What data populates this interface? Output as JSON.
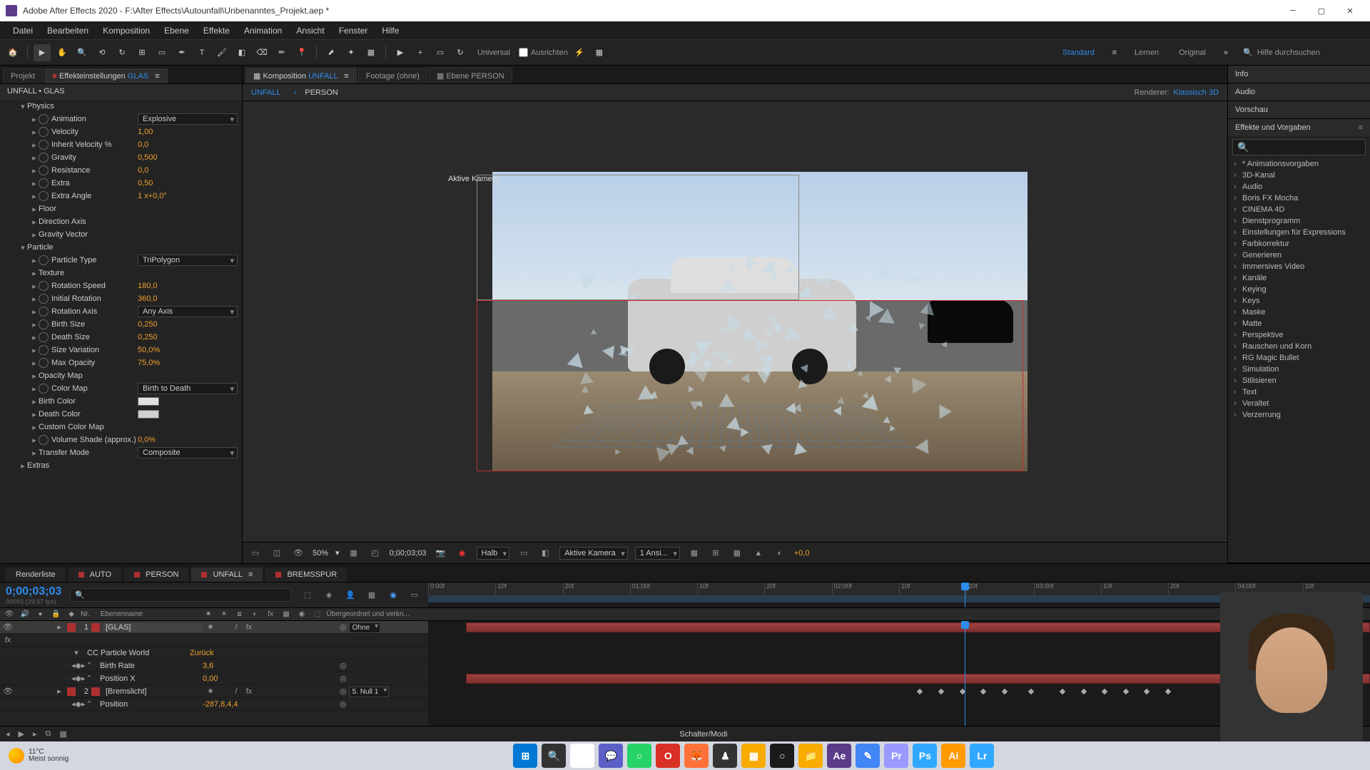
{
  "titlebar": {
    "title": "Adobe After Effects 2020 - F:\\After Effects\\Autounfall\\Unbenanntes_Projekt.aep *"
  },
  "menubar": [
    "Datei",
    "Bearbeiten",
    "Komposition",
    "Ebene",
    "Effekte",
    "Animation",
    "Ansicht",
    "Fenster",
    "Hilfe"
  ],
  "toolbar": {
    "universal": "Universal",
    "ausrichten": "Ausrichten",
    "workspaces": {
      "active": "Standard",
      "items": [
        "Lernen",
        "Original"
      ]
    },
    "search_placeholder": "Hilfe durchsuchen"
  },
  "left_panel": {
    "tabs": {
      "projekt": "Projekt",
      "effekt": "Effekteinstellungen",
      "effekt_layer": "GLAS"
    },
    "title": "UNFALL • GLAS",
    "groups": [
      {
        "name": "Physics",
        "open": true
      },
      {
        "name": "Particle",
        "open": true
      },
      {
        "name": "Extras",
        "open": false
      }
    ],
    "rows": [
      {
        "indent": 2,
        "kf": true,
        "label": "Animation",
        "type": "dropdown",
        "value": "Explosive"
      },
      {
        "indent": 2,
        "kf": true,
        "label": "Velocity",
        "type": "num",
        "value": "1,00"
      },
      {
        "indent": 2,
        "kf": true,
        "label": "Inherit Velocity %",
        "type": "num",
        "value": "0,0"
      },
      {
        "indent": 2,
        "kf": true,
        "label": "Gravity",
        "type": "num",
        "value": "0,500"
      },
      {
        "indent": 2,
        "kf": true,
        "label": "Resistance",
        "type": "num",
        "value": "0,0"
      },
      {
        "indent": 2,
        "kf": true,
        "label": "Extra",
        "type": "num",
        "value": "0,50"
      },
      {
        "indent": 2,
        "kf": true,
        "label": "Extra Angle",
        "type": "num",
        "value": "1 x+0,0°"
      },
      {
        "indent": 2,
        "kf": false,
        "label": "Floor",
        "type": "twirl"
      },
      {
        "indent": 2,
        "kf": false,
        "label": "Direction Axis",
        "type": "twirl"
      },
      {
        "indent": 2,
        "kf": false,
        "label": "Gravity Vector",
        "type": "twirl"
      },
      {
        "indent": 1,
        "kf": false,
        "label": "Particle",
        "type": "section"
      },
      {
        "indent": 2,
        "kf": true,
        "label": "Particle Type",
        "type": "dropdown",
        "value": "TriPolygon"
      },
      {
        "indent": 2,
        "kf": false,
        "label": "Texture",
        "type": "twirl"
      },
      {
        "indent": 2,
        "kf": true,
        "label": "Rotation Speed",
        "type": "num",
        "value": "180,0"
      },
      {
        "indent": 2,
        "kf": true,
        "label": "Initial Rotation",
        "type": "num",
        "value": "360,0"
      },
      {
        "indent": 2,
        "kf": true,
        "label": "Rotation Axis",
        "type": "dropdown",
        "value": "Any Axis"
      },
      {
        "indent": 2,
        "kf": true,
        "label": "Birth Size",
        "type": "num",
        "value": "0,250"
      },
      {
        "indent": 2,
        "kf": true,
        "label": "Death Size",
        "type": "num",
        "value": "0,250"
      },
      {
        "indent": 2,
        "kf": true,
        "label": "Size Variation",
        "type": "num",
        "value": "50,0%"
      },
      {
        "indent": 2,
        "kf": true,
        "label": "Max Opacity",
        "type": "num",
        "value": "75,0%"
      },
      {
        "indent": 2,
        "kf": false,
        "label": "Opacity Map",
        "type": "twirl"
      },
      {
        "indent": 2,
        "kf": true,
        "label": "Color Map",
        "type": "dropdown",
        "value": "Birth to Death"
      },
      {
        "indent": 2,
        "kf": false,
        "label": "Birth Color",
        "type": "swatch",
        "color": "#e0e0e0"
      },
      {
        "indent": 2,
        "kf": false,
        "label": "Death Color",
        "type": "swatch",
        "color": "#d0d0d0"
      },
      {
        "indent": 2,
        "kf": false,
        "label": "Custom Color Map",
        "type": "twirl"
      },
      {
        "indent": 2,
        "kf": true,
        "label": "Volume Shade (approx.)",
        "type": "num",
        "value": "0,0%"
      },
      {
        "indent": 2,
        "kf": false,
        "label": "Transfer Mode",
        "type": "dropdown",
        "value": "Composite"
      },
      {
        "indent": 1,
        "kf": false,
        "label": "Extras",
        "type": "section-closed"
      }
    ]
  },
  "center": {
    "tabs": [
      {
        "label": "Komposition",
        "name": "UNFALL",
        "active": true
      },
      {
        "label": "Footage",
        "name": "(ohne)"
      },
      {
        "label": "Ebene",
        "name": "PERSON"
      }
    ],
    "breadcrumb": {
      "items": [
        "UNFALL",
        "PERSON"
      ],
      "renderer_lbl": "Renderer:",
      "renderer": "Klassisch 3D"
    },
    "camera_label": "Aktive Kamera",
    "footer": {
      "zoom": "50%",
      "timecode": "0;00;03;03",
      "res": "Halb",
      "camera": "Aktive Kamera",
      "views": "1 Ansi...",
      "exposure": "+0,0"
    }
  },
  "right": {
    "info": "Info",
    "audio": "Audio",
    "vorschau": "Vorschau",
    "effects": {
      "title": "Effekte und Vorgaben",
      "items": [
        "* Animationsvorgaben",
        "3D-Kanal",
        "Audio",
        "Boris FX Mocha",
        "CINEMA 4D",
        "Dienstprogramm",
        "Einstellungen für Expressions",
        "Farbkorrektur",
        "Generieren",
        "Immersives Video",
        "Kanäle",
        "Keying",
        "Keys",
        "Maske",
        "Matte",
        "Perspektive",
        "Rauschen und Korn",
        "RG Magic Bullet",
        "Simulation",
        "Stilisieren",
        "Text",
        "Veraltet",
        "Verzerrung"
      ]
    }
  },
  "timeline": {
    "tabs": [
      "Renderliste",
      "AUTO",
      "PERSON",
      "UNFALL",
      "BREMSSPUR"
    ],
    "active_tab": "UNFALL",
    "timecode": "0;00;03;03",
    "timecode_sub": "00093 (29,97 fps)",
    "ruler": [
      "0:00f",
      "10f",
      "20f",
      "01;00f",
      "10f",
      "20f",
      "02;00f",
      "10f",
      "20f",
      "03;00f",
      "10f",
      "20f",
      "04;00f",
      "10f"
    ],
    "cols": {
      "nr": "Nr.",
      "name": "Ebenenname",
      "parent": "Übergeordnet und verkn..."
    },
    "layers": [
      {
        "num": "1",
        "color": "#b03030",
        "name": "[GLAS]",
        "selected": true,
        "parent": "Ohne"
      },
      {
        "sub": true,
        "name": "CC Particle World",
        "val": "Zurück"
      },
      {
        "sub": true,
        "kf": true,
        "name": "Birth Rate",
        "val": "3,6"
      },
      {
        "sub": true,
        "kf": true,
        "name": "Position X",
        "val": "0,00"
      },
      {
        "num": "2",
        "color": "#b03030",
        "name": "[Bremslicht]",
        "parent": "5. Null 1"
      },
      {
        "sub": true,
        "kf": true,
        "name": "Position",
        "val": "-287,8,4,4"
      }
    ],
    "footer": "Schalter/Modi"
  },
  "taskbar": {
    "temp": "11°C",
    "cond": "Meist sonnig",
    "apps": [
      {
        "bg": "#0078d4",
        "label": "⊞"
      },
      {
        "bg": "#333",
        "label": "🔍"
      },
      {
        "bg": "#fff",
        "label": "▭"
      },
      {
        "bg": "#5b5fc7",
        "label": "💬"
      },
      {
        "bg": "#25d366",
        "label": "○"
      },
      {
        "bg": "#d93025",
        "label": "O"
      },
      {
        "bg": "#ff7139",
        "label": "🦊"
      },
      {
        "bg": "#333",
        "label": "♟"
      },
      {
        "bg": "#f9ab00",
        "label": "▦"
      },
      {
        "bg": "#1a1a1a",
        "label": "○"
      },
      {
        "bg": "#f9ab00",
        "label": "📁"
      },
      {
        "bg": "#5b3b8a",
        "label": "Ae"
      },
      {
        "bg": "#4285f4",
        "label": "✎"
      },
      {
        "bg": "#9999ff",
        "label": "Pr"
      },
      {
        "bg": "#31a8ff",
        "label": "Ps"
      },
      {
        "bg": "#ff9a00",
        "label": "Ai"
      },
      {
        "bg": "#31a8ff",
        "label": "Lr"
      }
    ]
  }
}
